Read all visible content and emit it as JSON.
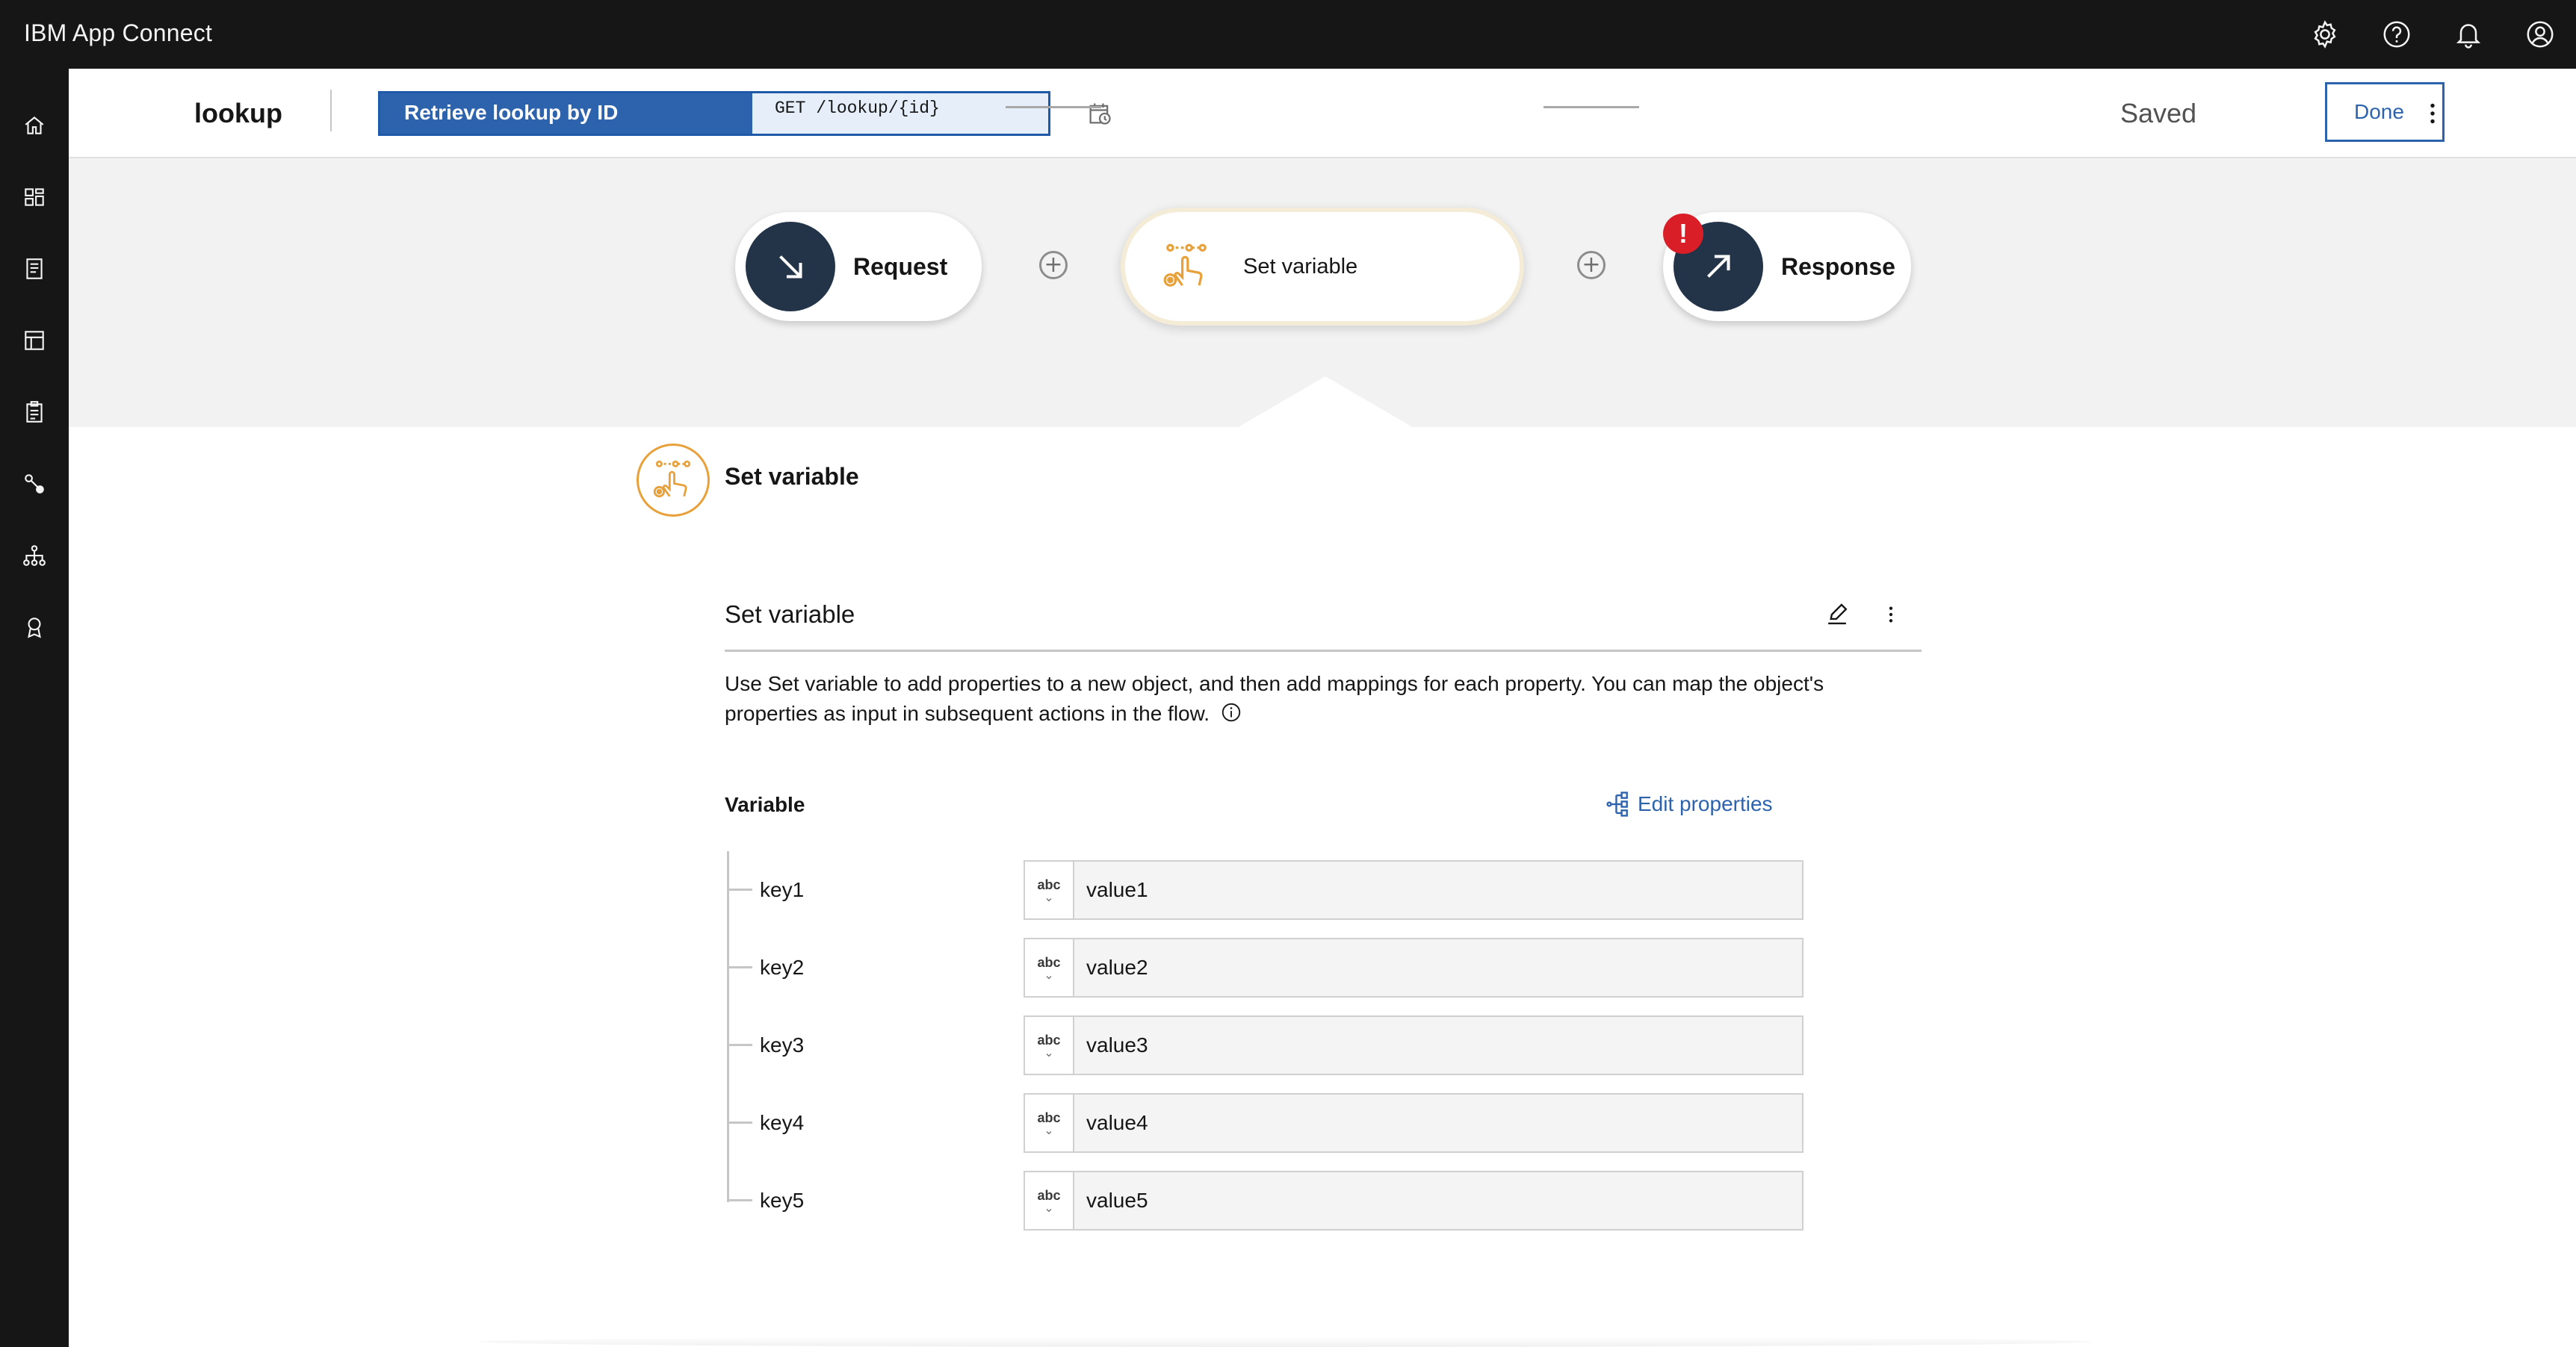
{
  "app": {
    "title": "IBM App Connect"
  },
  "topbar_icons": [
    "settings-icon",
    "help-icon",
    "notification-icon",
    "user-avatar-icon"
  ],
  "rail_icons": [
    "home-icon",
    "dashboard-icon",
    "catalog-icon",
    "templates-icon",
    "logs-icon",
    "connections-icon",
    "hierarchy-icon",
    "badge-icon"
  ],
  "subheader": {
    "flow_name": "lookup",
    "operation_title": "Retrieve lookup by ID",
    "operation_path": "GET /lookup/{id}",
    "status": "Saved",
    "done_label": "Done"
  },
  "flow": {
    "request_label": "Request",
    "set_variable_label": "Set variable",
    "response_label": "Response",
    "plus_symbol": "+",
    "error_symbol": "!"
  },
  "panel": {
    "title": "Set variable",
    "section_title": "Set variable",
    "description": "Use Set variable to add properties to a new object, and then add mappings for each property. You can map the object's properties as input in subsequent actions in the flow.",
    "variable_label": "Variable",
    "edit_properties_label": "Edit properties",
    "type_label": "abc",
    "type_chevron": "⌄",
    "rows": [
      {
        "key": "key1",
        "value": "value1"
      },
      {
        "key": "key2",
        "value": "value2"
      },
      {
        "key": "key3",
        "value": "value3"
      },
      {
        "key": "key4",
        "value": "value4"
      },
      {
        "key": "key5",
        "value": "value5"
      }
    ]
  },
  "colors": {
    "header_bg": "#161616",
    "accent_blue": "#2d63ad",
    "node_dark": "#233348",
    "set_variable_orange": "#e8a13a",
    "error_red": "#da1e28",
    "canvas_bg": "#f2f2f2"
  }
}
